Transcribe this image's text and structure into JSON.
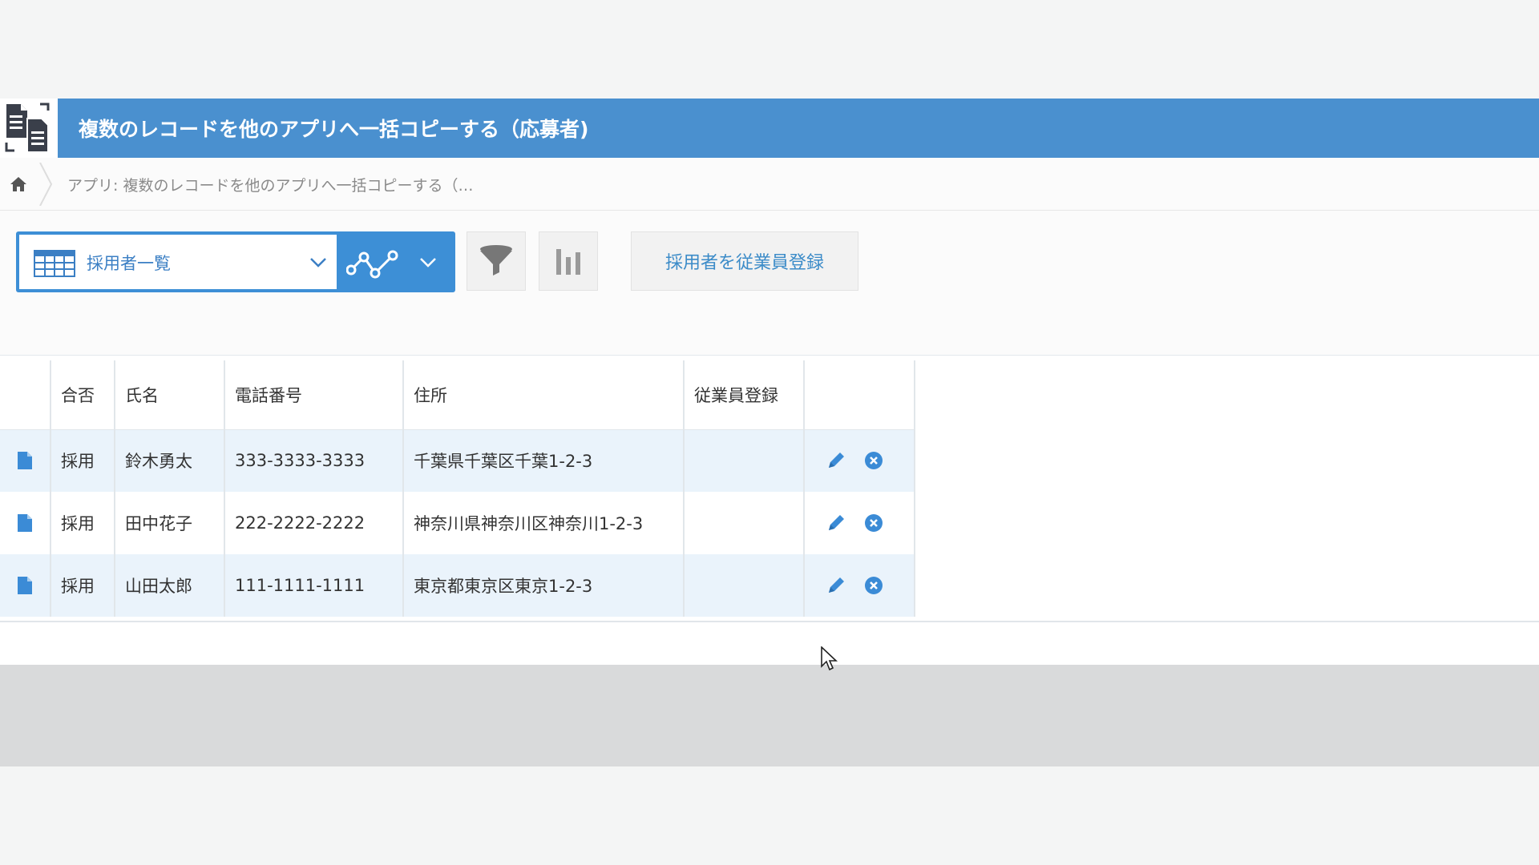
{
  "header": {
    "title": "複数のレコードを他のアプリへ一括コピーする（応募者)"
  },
  "breadcrumb": {
    "text": "アプリ: 複数のレコードを他のアプリへ一括コピーする（…"
  },
  "toolbar": {
    "view_label": "採用者一覧",
    "action_button": "採用者を従業員登録"
  },
  "table": {
    "columns": [
      "合否",
      "氏名",
      "電話番号",
      "住所",
      "従業員登録"
    ],
    "rows": [
      {
        "pass": "採用",
        "name": "鈴木勇太",
        "phone": "333-3333-3333",
        "address": "千葉県千葉区千葉1-2-3",
        "registered": ""
      },
      {
        "pass": "採用",
        "name": "田中花子",
        "phone": "222-2222-2222",
        "address": "神奈川県神奈川区神奈川1-2-3",
        "registered": ""
      },
      {
        "pass": "採用",
        "name": "山田太郎",
        "phone": "111-1111-1111",
        "address": "東京都東京区東京1-2-3",
        "registered": ""
      }
    ]
  },
  "icons": {
    "app": "copy-records-icon",
    "home": "home-icon",
    "view": "table-grid-icon",
    "graph": "line-graph-icon",
    "filter": "funnel-icon",
    "chart": "bar-chart-icon",
    "record": "document-icon",
    "edit": "pencil-icon",
    "delete": "close-circle-icon",
    "cursor": "mouse-pointer-icon"
  },
  "colors": {
    "accent": "#4a90cf",
    "link": "#3b8bc8",
    "row_highlight": "#eaf3fb"
  }
}
